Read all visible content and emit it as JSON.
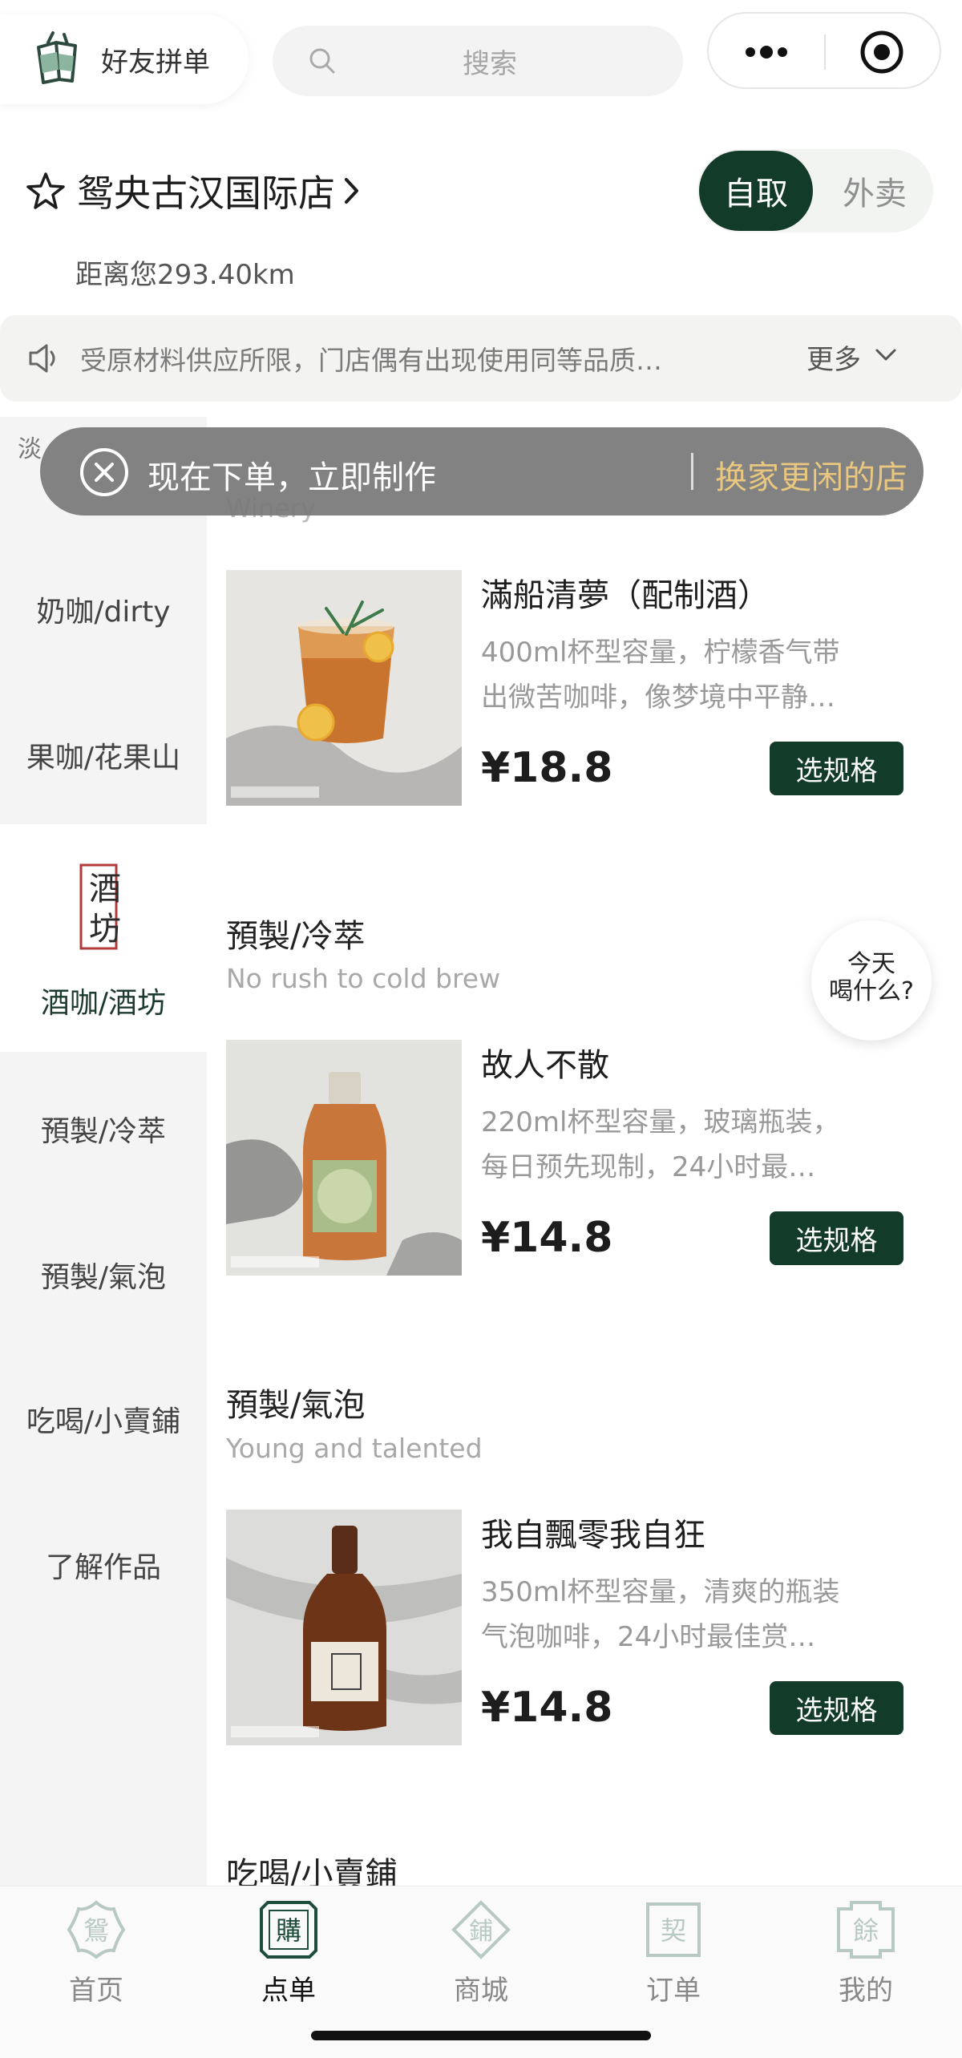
{
  "header": {
    "group_order_label": "好友拼单",
    "search_placeholder": "搜索"
  },
  "store": {
    "name": "鸳央古汉国际店",
    "distance": "距离您293.40km",
    "mode_pickup": "自取",
    "mode_delivery": "外卖"
  },
  "notice": {
    "text": "受原材料供应所限，门店偶有出现使用同等品质…",
    "more_label": "更多"
  },
  "toast": {
    "message": "现在下单，立即制作",
    "action": "换家更闲的店"
  },
  "sidebar": {
    "partial_item": "淡",
    "items": [
      {
        "label": "奶咖/dirty"
      },
      {
        "label": "果咖/花果山"
      },
      {
        "label": "酒咖/酒坊",
        "seal_text": "酒坊"
      },
      {
        "label": "預製/冷萃"
      },
      {
        "label": "預製/氣泡"
      },
      {
        "label": "吃喝/小賣鋪"
      },
      {
        "label": "了解作品"
      }
    ]
  },
  "sections": [
    {
      "title": "預製/冷萃",
      "subtitle": "No rush to cold brew"
    },
    {
      "title": "預製/氣泡",
      "subtitle": "Young and talented"
    },
    {
      "title": "吃喝/小賣鋪"
    }
  ],
  "partial_subtitle": "Winery",
  "products": [
    {
      "name": "滿船清夢（配制酒）",
      "desc_line1": "400ml杯型容量，柠檬香气带",
      "desc_line2": "出微苦咖啡，像梦境中平静…",
      "price": "¥18.8",
      "button": "选规格"
    },
    {
      "name": "故人不散",
      "desc_line1": "220ml杯型容量，玻璃瓶装，",
      "desc_line2": "每日预先现制，24小时最…",
      "price": "¥14.8",
      "button": "选规格"
    },
    {
      "name": "我自飄零我自狂",
      "desc_line1": "350ml杯型容量，清爽的瓶装",
      "desc_line2": "气泡咖啡，24小时最佳赏…",
      "price": "¥14.8",
      "button": "选规格"
    }
  ],
  "bubble": {
    "line1": "今天",
    "line2": "喝什么?"
  },
  "bottom_nav": [
    {
      "label": "首页",
      "icon_char": "鴛"
    },
    {
      "label": "点单",
      "icon_char": "購"
    },
    {
      "label": "商城",
      "icon_char": "鋪"
    },
    {
      "label": "订单",
      "icon_char": "契"
    },
    {
      "label": "我的",
      "icon_char": "餘"
    }
  ],
  "colors": {
    "brand_green": "#123b2a",
    "toast_link": "#e9c77e",
    "nav_icon": "#b8c9c3",
    "nav_icon_active": "#1f4d3c"
  }
}
